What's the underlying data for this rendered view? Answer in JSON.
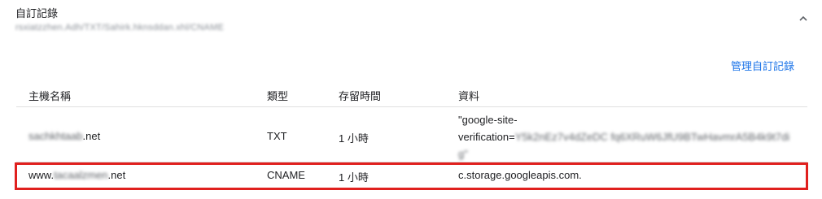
{
  "section": {
    "title": "自訂記錄",
    "subtitle": "rsxiatzzhen.Adh/TXT/Sahirk.hknsddan.xhl/CNAME"
  },
  "actions": {
    "manage_label": "管理自訂記錄"
  },
  "icons": {
    "collapse": "chevron-up-icon"
  },
  "table": {
    "columns": [
      "主機名稱",
      "類型",
      "存留時間",
      "資料"
    ],
    "rows": [
      {
        "host_blurred": "sachkhtaab",
        "host_suffix": ".net",
        "type": "TXT",
        "ttl": "1 小時",
        "data_line1": "\"google-site-",
        "data_prefix": "verification=",
        "data_blurred": "Y5k2nEz7v4dZeDC fq6XRuW6JfU9BTwHavmrA5B4k9t7di",
        "data_line3_blurred": "g\""
      },
      {
        "host_prefix": "www.",
        "host_blurred": "tacaalzmen",
        "host_suffix": ".net",
        "type": "CNAME",
        "ttl": "1 小時",
        "data": "c.storage.googleapis.com."
      }
    ]
  },
  "colors": {
    "link": "#1a73e8",
    "highlight": "#e0201e",
    "divider": "#e0e0e0"
  }
}
